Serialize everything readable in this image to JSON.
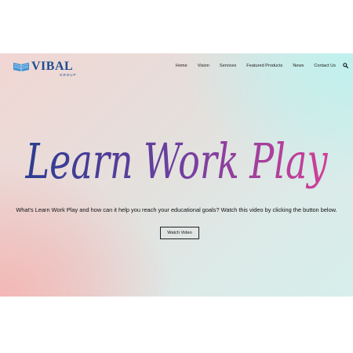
{
  "brand": {
    "name": "VIBAL",
    "subtitle": "GROUP",
    "logo_icon": "open-book-icon",
    "color": "#1d4c8f"
  },
  "nav": {
    "items": [
      "Home",
      "Vision",
      "Services",
      "Featured Products",
      "News",
      "Contact Us"
    ],
    "search_icon": "search-icon"
  },
  "hero": {
    "words": [
      "Learn",
      "Work",
      "Play"
    ],
    "gradient_colors": [
      "#2a3d91",
      "#6d3fa0",
      "#d23f98"
    ]
  },
  "tagline": "What's Learn Work Play and how can it help you reach your educational goals? Watch this video by clicking the button below.",
  "cta": {
    "label": "Watch Video"
  },
  "background_colors": {
    "pink": "#f3b7b5",
    "mint": "#bff1ee"
  }
}
